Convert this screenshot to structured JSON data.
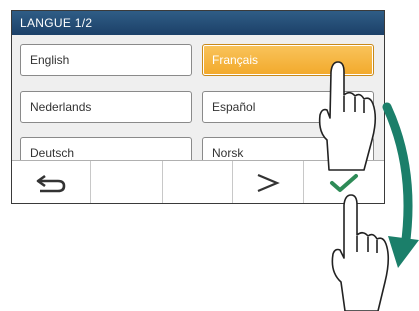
{
  "titlebar": {
    "title": "LANGUE  1/2"
  },
  "languages": [
    {
      "label": "English",
      "selected": false
    },
    {
      "label": "Français",
      "selected": true
    },
    {
      "label": "Nederlands",
      "selected": false
    },
    {
      "label": "Español",
      "selected": false
    },
    {
      "label": "Deutsch",
      "selected": false
    },
    {
      "label": "Norsk",
      "selected": false
    }
  ],
  "bottombar": {
    "icons": [
      "back-arrow-icon",
      "",
      "",
      "next-chevron-icon",
      "confirm-check-icon"
    ],
    "check_color": "#2e8b57"
  },
  "colors": {
    "title_bg": "#1c4068",
    "selected_bg": "#f2a92b",
    "arrow": "#1b7f6a"
  }
}
